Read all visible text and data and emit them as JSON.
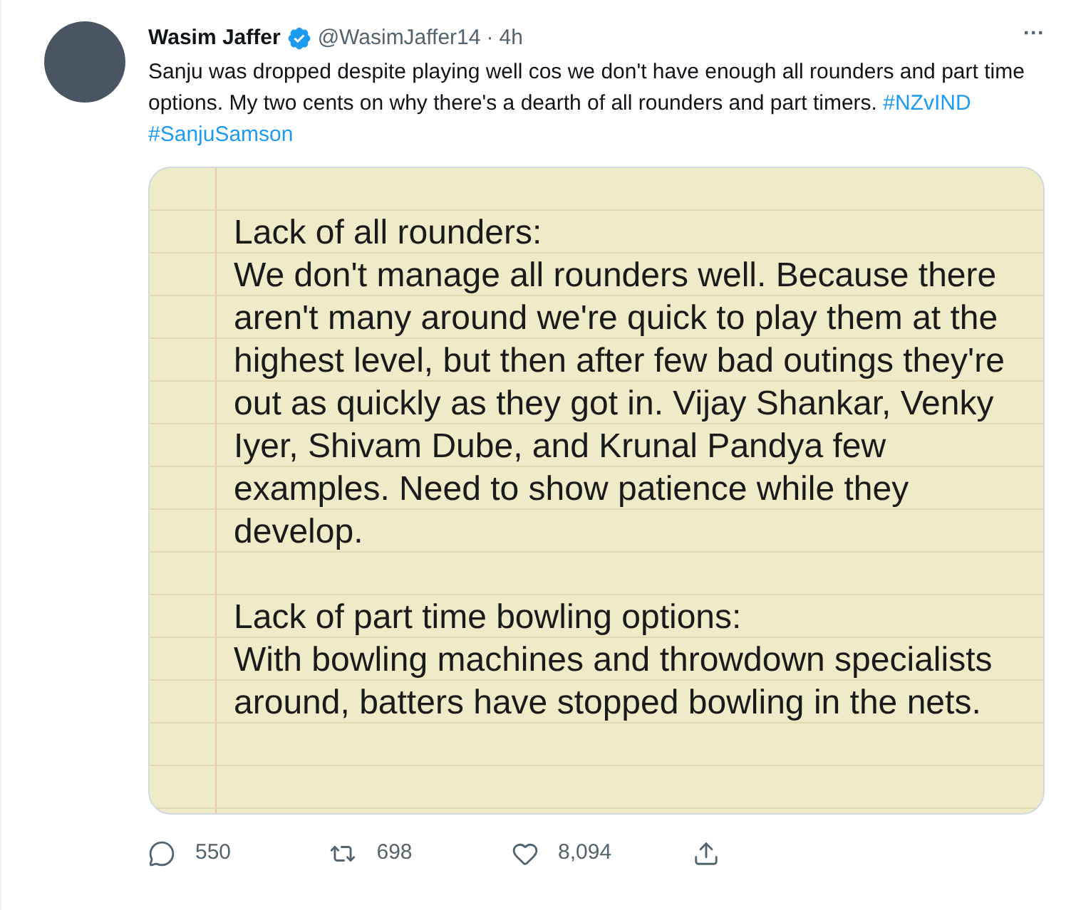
{
  "author": {
    "name": "Wasim Jaffer",
    "verified": true,
    "handle": "@WasimJaffer14",
    "separator": "·",
    "time": "4h"
  },
  "more": "···",
  "text": {
    "body": "Sanju was dropped despite playing well cos we don't have enough all rounders and part time options. My two cents on why there's a dearth of all rounders and part timers.",
    "hashtags": [
      "#NZvIND",
      "#SanjuSamson"
    ]
  },
  "note": {
    "sections": [
      {
        "heading": "Lack of all rounders:",
        "body": "We don't manage all rounders well. Because there aren't many around we're quick to play them at the highest level, but then after few bad outings they're out as quickly as they got in. Vijay Shankar, Venky Iyer, Shivam Dube, and Krunal Pandya few examples. Need to show patience while they develop."
      },
      {
        "heading": "Lack of part time bowling options:",
        "body": "With bowling machines and throwdown specialists around, batters have stopped bowling in the nets."
      }
    ]
  },
  "actions": [
    {
      "kind": "reply",
      "count": "550"
    },
    {
      "kind": "retweet",
      "count": "698"
    },
    {
      "kind": "like",
      "count": "8,094"
    },
    {
      "kind": "share"
    }
  ]
}
